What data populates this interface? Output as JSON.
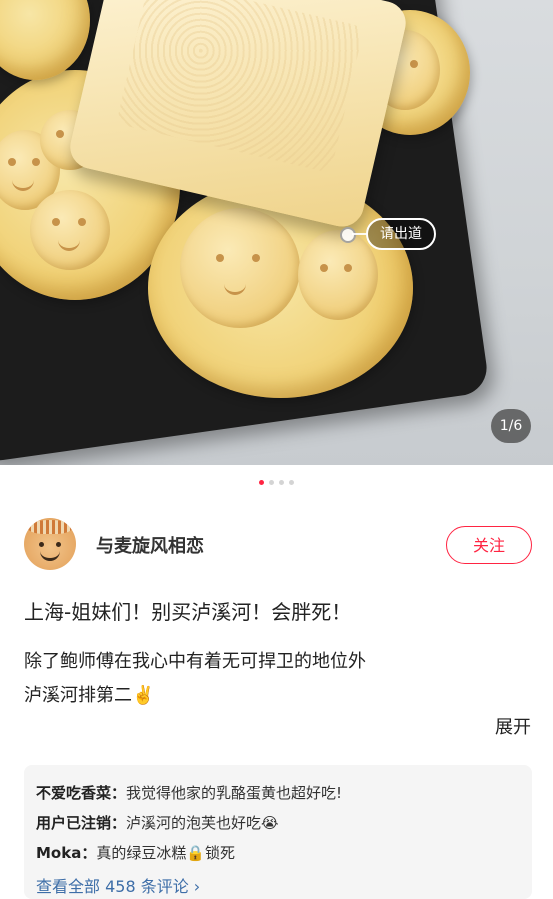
{
  "photo": {
    "product_tag": "请出道",
    "counter": "1/6",
    "pages_total": 6,
    "page_active": 1
  },
  "author": {
    "name": "与麦旋风相恋",
    "follow_label": "关注"
  },
  "post": {
    "title": "上海-姐妹们！别买泸溪河！会胖死！",
    "line1": "除了鲍师傅在我心中有着无可捍卫的地位外",
    "line2": "泸溪河排第二",
    "line2_emoji": "✌️",
    "expand_label": "展开"
  },
  "comments": {
    "items": [
      {
        "user": "不爱吃香菜：",
        "text": "我觉得他家的乳酪蛋黄也超好吃!",
        "emoji": ""
      },
      {
        "user": "用户已注销：",
        "text": "泸溪河的泡芙也好吃",
        "emoji": "😭"
      },
      {
        "user": "Moka：",
        "text": "真的绿豆冰糕",
        "emoji": "🔒",
        "text_after": "锁死"
      }
    ],
    "view_all": "查看全部 458 条评论 ›"
  },
  "colors": {
    "accent": "#ff2442",
    "link": "#3e6ea8"
  }
}
